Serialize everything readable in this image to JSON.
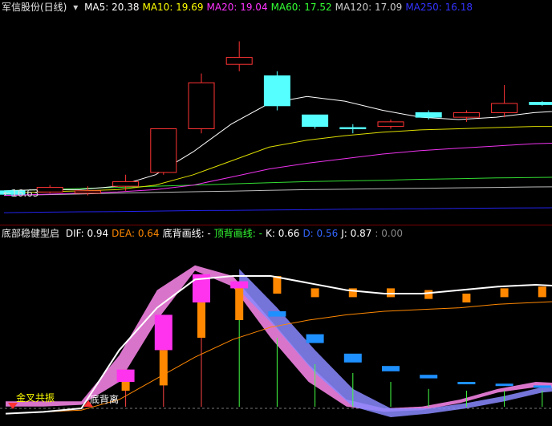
{
  "top_panel": {
    "stock_title": "军信股份(日线)",
    "ma_items": [
      {
        "name": "MA5",
        "value": "20.38",
        "color": "#ffffff"
      },
      {
        "name": "MA10",
        "value": "19.69",
        "color": "#ffff00"
      },
      {
        "name": "MA20",
        "value": "19.04",
        "color": "#ff33ff"
      },
      {
        "name": "MA60",
        "value": "17.52",
        "color": "#33ff33"
      },
      {
        "name": "MA120",
        "value": "17.09",
        "color": "#cccccc"
      },
      {
        "name": "MA250",
        "value": "16.18",
        "color": "#3333ff"
      }
    ],
    "low_price_label": "16.63",
    "candles": [
      {
        "o": 16.9,
        "c": 16.75,
        "h": 16.95,
        "l": 16.65
      },
      {
        "o": 16.85,
        "c": 17.05,
        "h": 17.15,
        "l": 16.8
      },
      {
        "o": 16.8,
        "c": 16.9,
        "h": 17.1,
        "l": 16.7
      },
      {
        "o": 17.1,
        "c": 17.3,
        "h": 17.6,
        "l": 16.9
      },
      {
        "o": 17.7,
        "c": 19.6,
        "h": 19.6,
        "l": 17.6
      },
      {
        "o": 19.6,
        "c": 21.6,
        "h": 22.0,
        "l": 19.4
      },
      {
        "o": 22.4,
        "c": 22.7,
        "h": 23.4,
        "l": 22.1
      },
      {
        "o": 21.9,
        "c": 20.6,
        "h": 22.1,
        "l": 20.4
      },
      {
        "o": 20.2,
        "c": 19.7,
        "h": 20.2,
        "l": 19.6
      },
      {
        "o": 19.65,
        "c": 19.6,
        "h": 19.8,
        "l": 19.4
      },
      {
        "o": 19.7,
        "c": 19.9,
        "h": 20.0,
        "l": 19.6
      },
      {
        "o": 20.3,
        "c": 20.1,
        "h": 20.4,
        "l": 20.0
      },
      {
        "o": 20.1,
        "c": 20.3,
        "h": 20.4,
        "l": 19.9
      },
      {
        "o": 20.3,
        "c": 20.7,
        "h": 21.5,
        "l": 20.1
      },
      {
        "o": 20.75,
        "c": 20.65,
        "h": 20.8,
        "l": 20.6
      },
      {
        "o": 20.5,
        "c": 20.45,
        "h": 20.9,
        "l": 20.3
      }
    ],
    "price_axis": {
      "min": 15.5,
      "max": 24.5
    }
  },
  "bottom_panel": {
    "indicator_name": "底部稳健型启",
    "items": [
      {
        "name": "DIF",
        "value": "0.94",
        "color": "#ffffff"
      },
      {
        "name": "DEA",
        "value": "0.64",
        "color": "#ff8800"
      },
      {
        "name": "底背画线",
        "value": "-",
        "color": "#ffffff"
      },
      {
        "name": "顶背画线",
        "value": "-",
        "color": "#33ff33"
      },
      {
        "name": "K",
        "value": "0.66",
        "color": "#ffffff"
      },
      {
        "name": "D",
        "value": "0.56",
        "color": "#3366ff"
      },
      {
        "name": "J",
        "value": "0.87",
        "color": "#ffffff"
      },
      {
        "name": "",
        "value": "0.00",
        "color": "#888888"
      }
    ],
    "signals": [
      {
        "text": "金叉共振",
        "color": "#ffff00"
      },
      {
        "text": "底背离",
        "color": "#ffffff"
      }
    ],
    "magenta_boxes": [
      {
        "i": 3,
        "top": 0.27,
        "bot": 0.2
      },
      {
        "i": 4,
        "top": 0.58,
        "bot": 0.38
      },
      {
        "i": 5,
        "top": 0.81,
        "bot": 0.65
      },
      {
        "i": 6,
        "top": 0.77,
        "bot": 0.73
      }
    ],
    "blue_boxes": [
      {
        "i": 7,
        "top": 0.6,
        "bot": 0.57
      },
      {
        "i": 8,
        "top": 0.47,
        "bot": 0.42
      },
      {
        "i": 9,
        "top": 0.36,
        "bot": 0.31
      },
      {
        "i": 10,
        "top": 0.29,
        "bot": 0.26
      },
      {
        "i": 11,
        "top": 0.24,
        "bot": 0.22
      },
      {
        "i": 12,
        "top": 0.2,
        "bot": 0.19
      },
      {
        "i": 13,
        "top": 0.19,
        "bot": 0.18
      },
      {
        "i": 14,
        "top": 0.18,
        "bot": 0.17
      }
    ],
    "dif": [
      0.02,
      0.03,
      0.05,
      0.38,
      0.62,
      0.78,
      0.8,
      0.8,
      0.76,
      0.72,
      0.7,
      0.7,
      0.72,
      0.74,
      0.75,
      0.74,
      0.73
    ],
    "dea": [
      0.02,
      0.03,
      0.04,
      0.1,
      0.22,
      0.34,
      0.44,
      0.51,
      0.55,
      0.58,
      0.6,
      0.61,
      0.62,
      0.64,
      0.65,
      0.66,
      0.67
    ]
  }
}
